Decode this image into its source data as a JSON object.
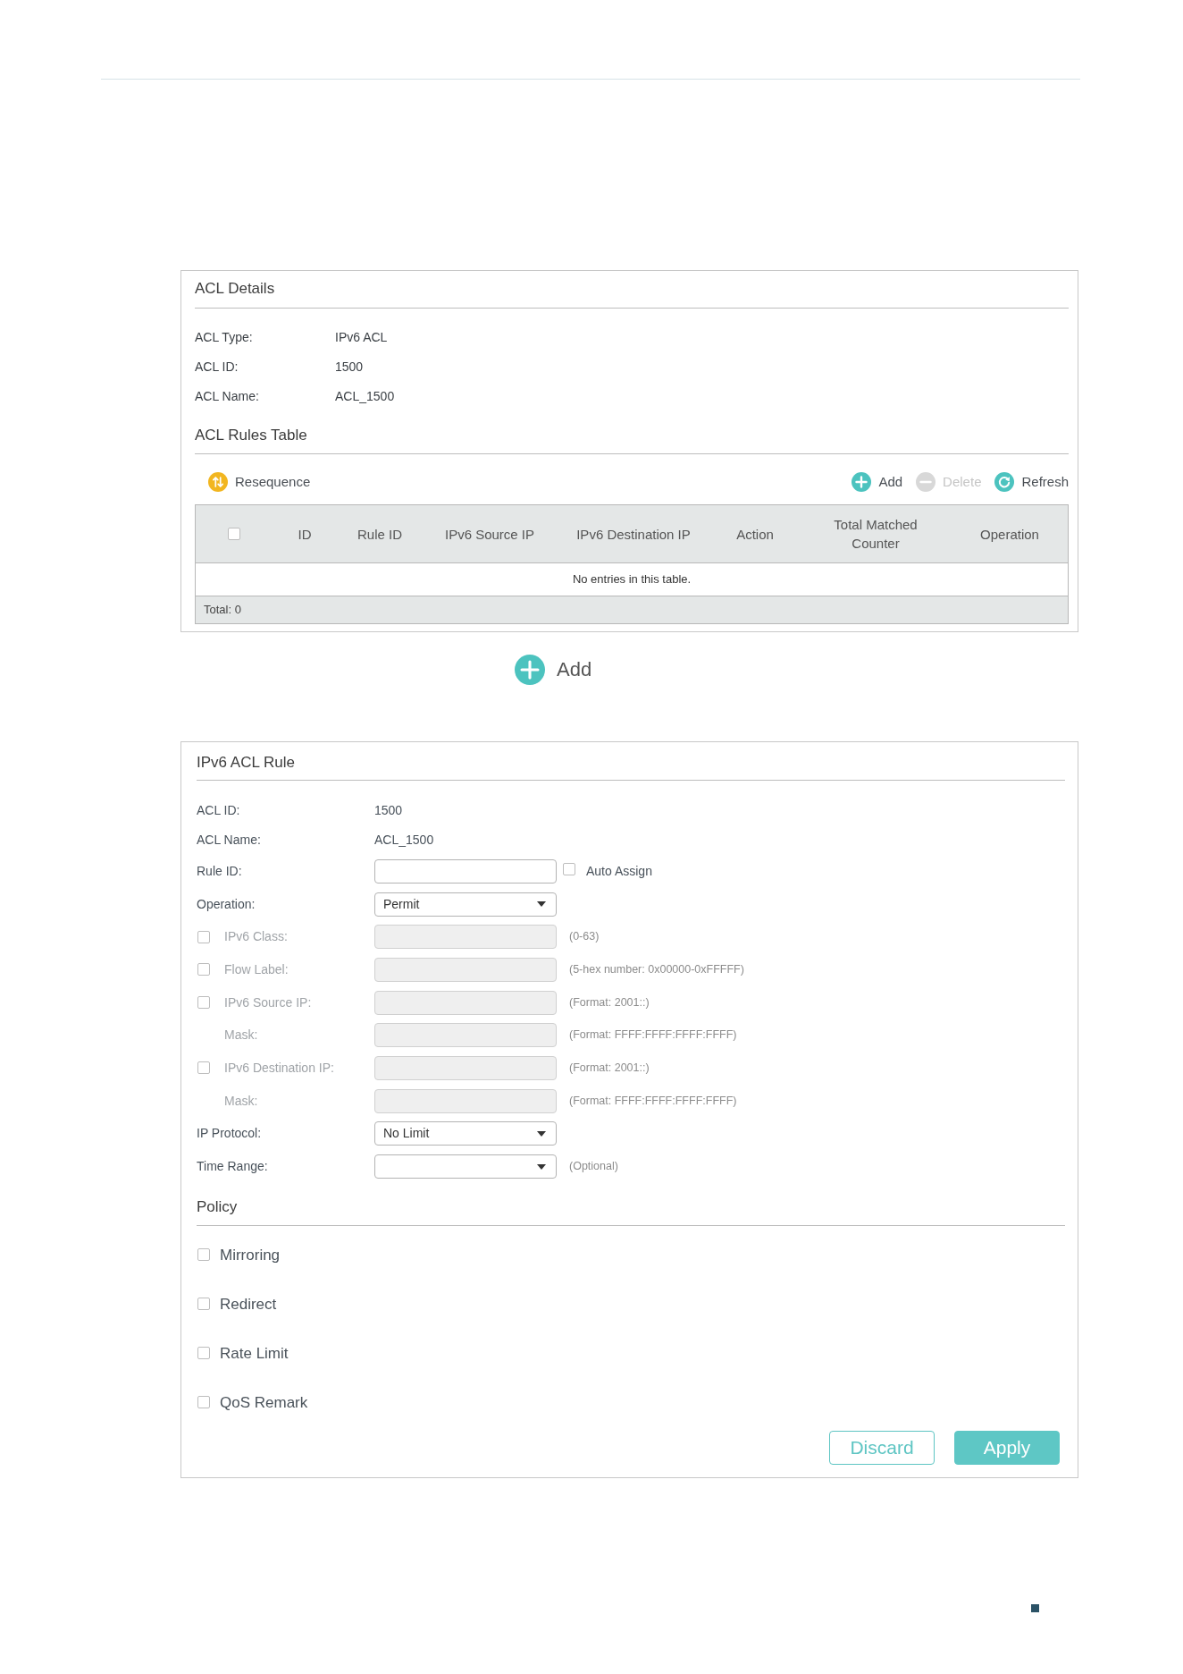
{
  "acl_details": {
    "title": "ACL Details",
    "fields": [
      {
        "label": "ACL Type:",
        "value": "IPv6 ACL"
      },
      {
        "label": "ACL ID:",
        "value": "1500"
      },
      {
        "label": "ACL Name:",
        "value": "ACL_1500"
      }
    ]
  },
  "rules_table": {
    "title": "ACL Rules Table",
    "toolbar_left": [
      {
        "kind": "resequence",
        "label": "Resequence",
        "disabled": false
      }
    ],
    "toolbar_right": [
      {
        "kind": "add",
        "label": "Add",
        "disabled": false
      },
      {
        "kind": "delete",
        "label": "Delete",
        "disabled": true
      },
      {
        "kind": "refresh",
        "label": "Refresh",
        "disabled": false
      }
    ],
    "select_all": {
      "checked": false
    },
    "columns": [
      "ID",
      "Rule ID",
      "IPv6 Source IP",
      "IPv6 Destination IP",
      "Action",
      "Total Matched Counter",
      "Operation"
    ],
    "empty_message": "No entries in this table.",
    "footer": "Total: 0"
  },
  "add_button": {
    "label": "Add"
  },
  "acl_rule": {
    "title": "IPv6 ACL Rule",
    "rows": [
      {
        "kind": "info",
        "label": "ACL ID:",
        "value": "1500",
        "disabled": false
      },
      {
        "kind": "info",
        "label": "ACL Name:",
        "value": "ACL_1500",
        "disabled": false
      },
      {
        "kind": "input",
        "label": "Rule ID:",
        "disabled": false,
        "option": {
          "label": "Auto Assign",
          "checked": false
        }
      },
      {
        "kind": "select",
        "label": "Operation:",
        "disabled": false,
        "value": "Permit"
      },
      {
        "kind": "input",
        "label": "IPv6 Class:",
        "disabled": true,
        "checkbox": {
          "checked": false
        },
        "hint": "(0-63)"
      },
      {
        "kind": "input",
        "label": "Flow Label:",
        "disabled": true,
        "checkbox": {
          "checked": false
        },
        "hint": "(5-hex number: 0x00000-0xFFFFF)"
      },
      {
        "kind": "input",
        "label": "IPv6 Source IP:",
        "disabled": true,
        "checkbox": {
          "checked": false
        },
        "hint": "(Format: 2001::)",
        "children": [
          {
            "kind": "input",
            "label": "Mask:",
            "disabled": true,
            "hint": "(Format: FFFF:FFFF:FFFF:FFFF)"
          }
        ]
      },
      {
        "kind": "input",
        "label": "IPv6 Destination IP:",
        "disabled": true,
        "checkbox": {
          "checked": false
        },
        "hint": "(Format: 2001::)",
        "children": [
          {
            "kind": "input",
            "label": "Mask:",
            "disabled": true,
            "hint": "(Format: FFFF:FFFF:FFFF:FFFF)"
          }
        ]
      },
      {
        "kind": "select",
        "label": "IP Protocol:",
        "disabled": false,
        "value": "No Limit"
      },
      {
        "kind": "select",
        "label": "Time Range:",
        "disabled": false,
        "hint": "(Optional)"
      }
    ],
    "policy": {
      "title": "Policy",
      "options": [
        {
          "label": "Mirroring",
          "checked": false
        },
        {
          "label": "Redirect",
          "checked": false
        },
        {
          "label": "Rate Limit",
          "checked": false
        },
        {
          "label": "QoS Remark",
          "checked": false
        }
      ]
    },
    "buttons": [
      {
        "kind": "secondary",
        "label": "Discard"
      },
      {
        "kind": "primary",
        "label": "Apply"
      }
    ]
  }
}
